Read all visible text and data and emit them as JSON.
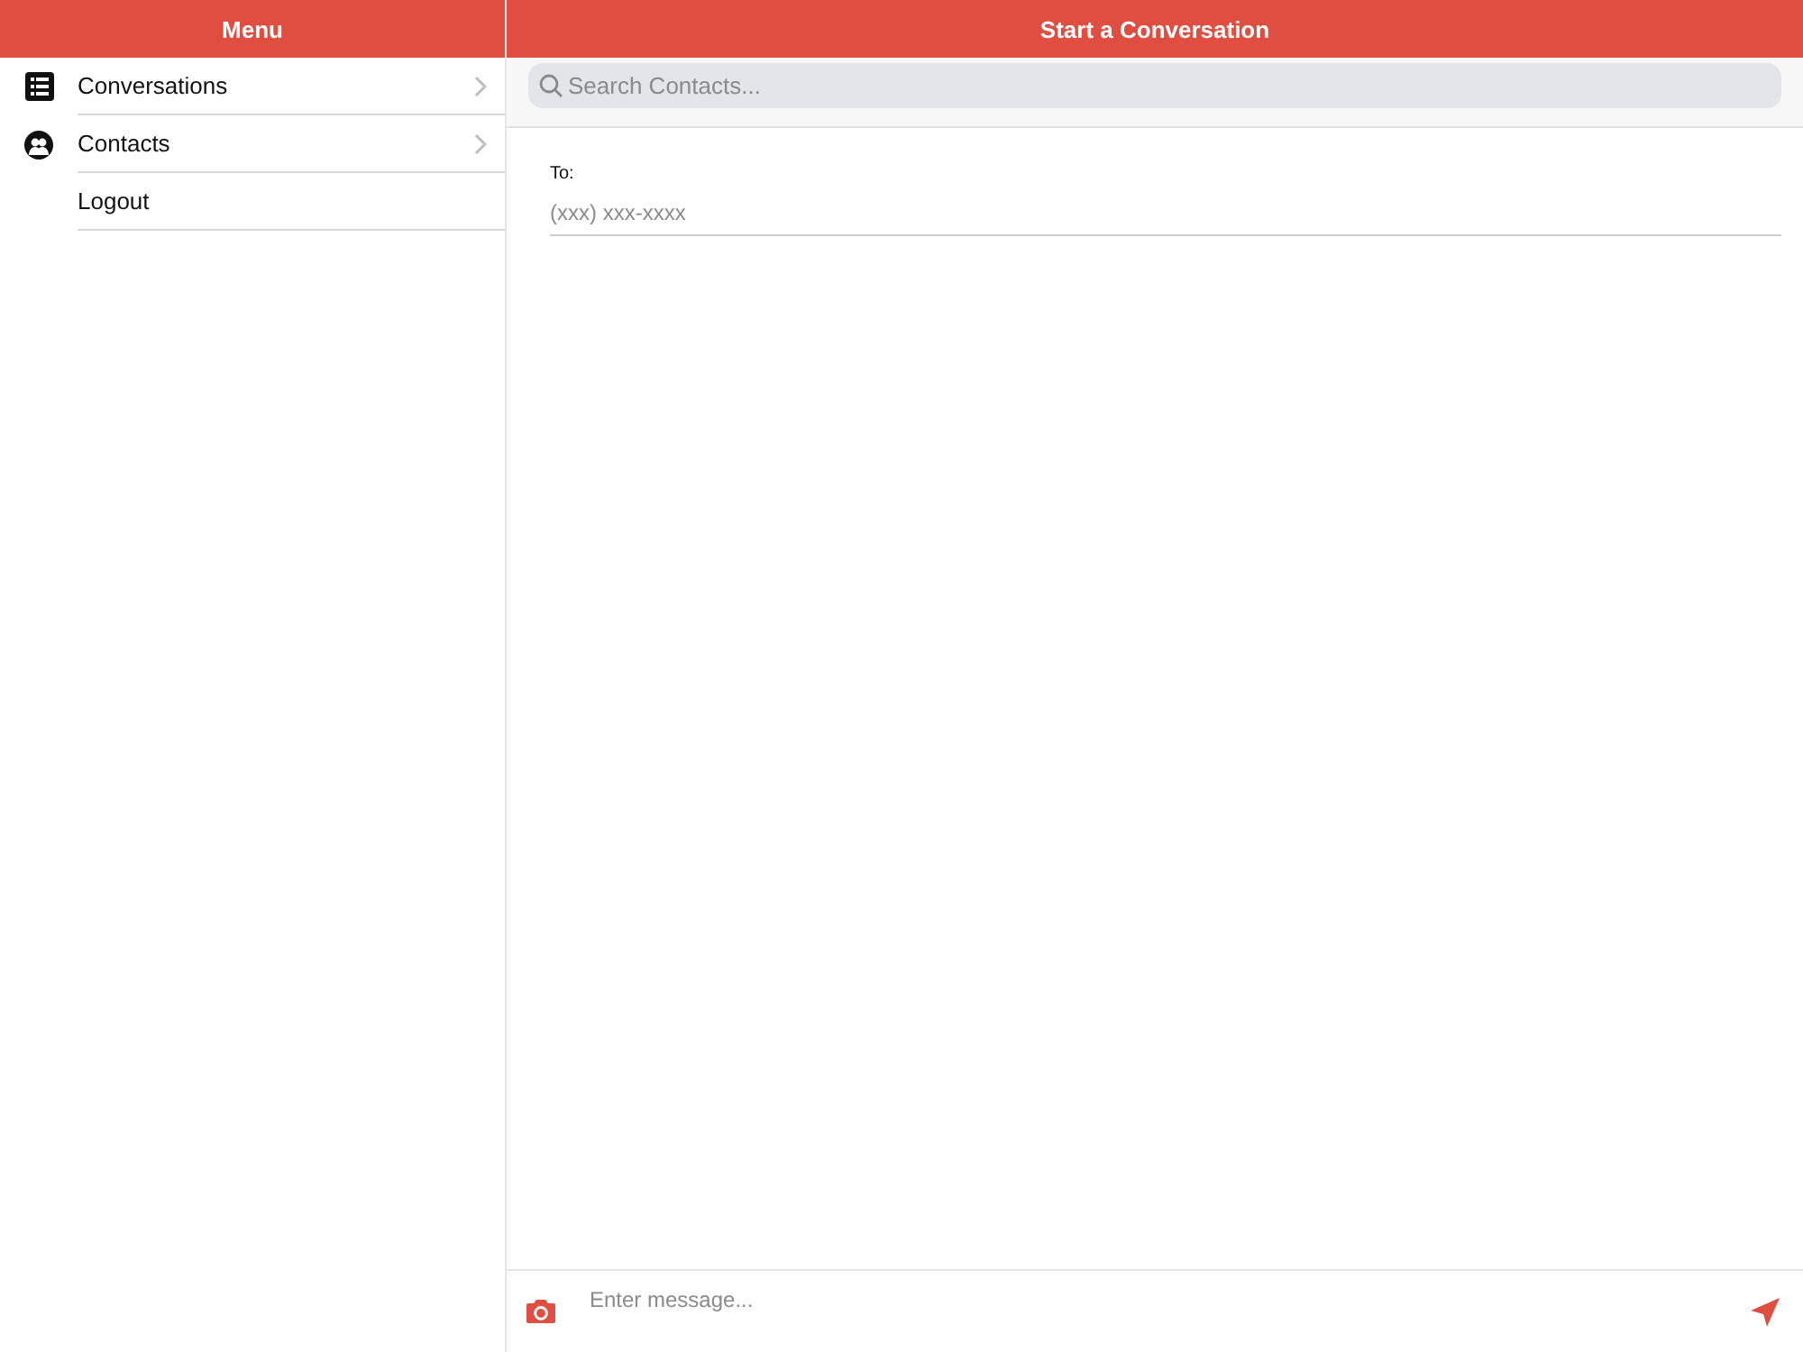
{
  "sidebar": {
    "title": "Menu",
    "items": [
      {
        "label": "Conversations",
        "kind": "nav"
      },
      {
        "label": "Contacts",
        "kind": "nav"
      },
      {
        "label": "Logout",
        "kind": "action"
      }
    ]
  },
  "main": {
    "title": "Start a Conversation",
    "search": {
      "placeholder": "Search Contacts..."
    },
    "to": {
      "label": "To:",
      "placeholder": "(xxx) xxx-xxxx"
    },
    "composer": {
      "placeholder": "Enter message..."
    }
  }
}
